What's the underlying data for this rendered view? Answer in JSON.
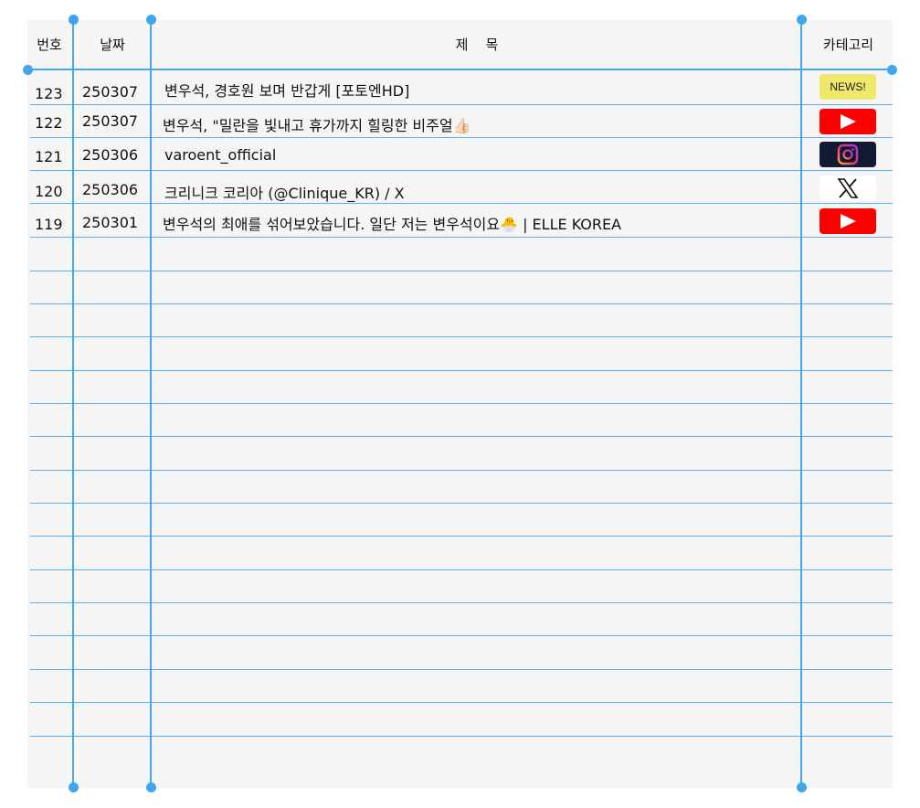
{
  "headers": {
    "num": "번호",
    "date": "날짜",
    "title": "제    목",
    "category": "카테고리"
  },
  "rows": [
    {
      "num": "123",
      "date": "250307",
      "title": "변우석, 경호원 보며 반갑게 [포토엔HD]",
      "category": "news",
      "category_label": "NEWS!"
    },
    {
      "num": "122",
      "date": "250307",
      "title": "변우석, \"밀란을 빛내고 휴가까지 힐링한 비주얼👍🏻",
      "category": "youtube",
      "category_label": ""
    },
    {
      "num": "121",
      "date": "250306",
      "title": "varoent_official",
      "category": "instagram",
      "category_label": ""
    },
    {
      "num": "120",
      "date": "250306",
      "title": "크리니크 코리아 (@Clinique_KR) / X",
      "category": "x",
      "category_label": ""
    },
    {
      "num": "119",
      "date": "250301",
      "title": "변우석의 최애를 섞어보았습니다. 일단 저는 변우석이요🐣 | ELLE KOREA",
      "category": "youtube",
      "category_label": ""
    }
  ],
  "icons": {
    "news": "news-badge",
    "youtube": "youtube-icon",
    "instagram": "instagram-icon",
    "x": "x-logo-icon"
  },
  "colors": {
    "grid_line": "#45a8ef",
    "news_badge": "#efe86a",
    "youtube": "#ff0000",
    "instagram_bg": "#121a33",
    "sheet_bg": "#f5f5f5"
  }
}
